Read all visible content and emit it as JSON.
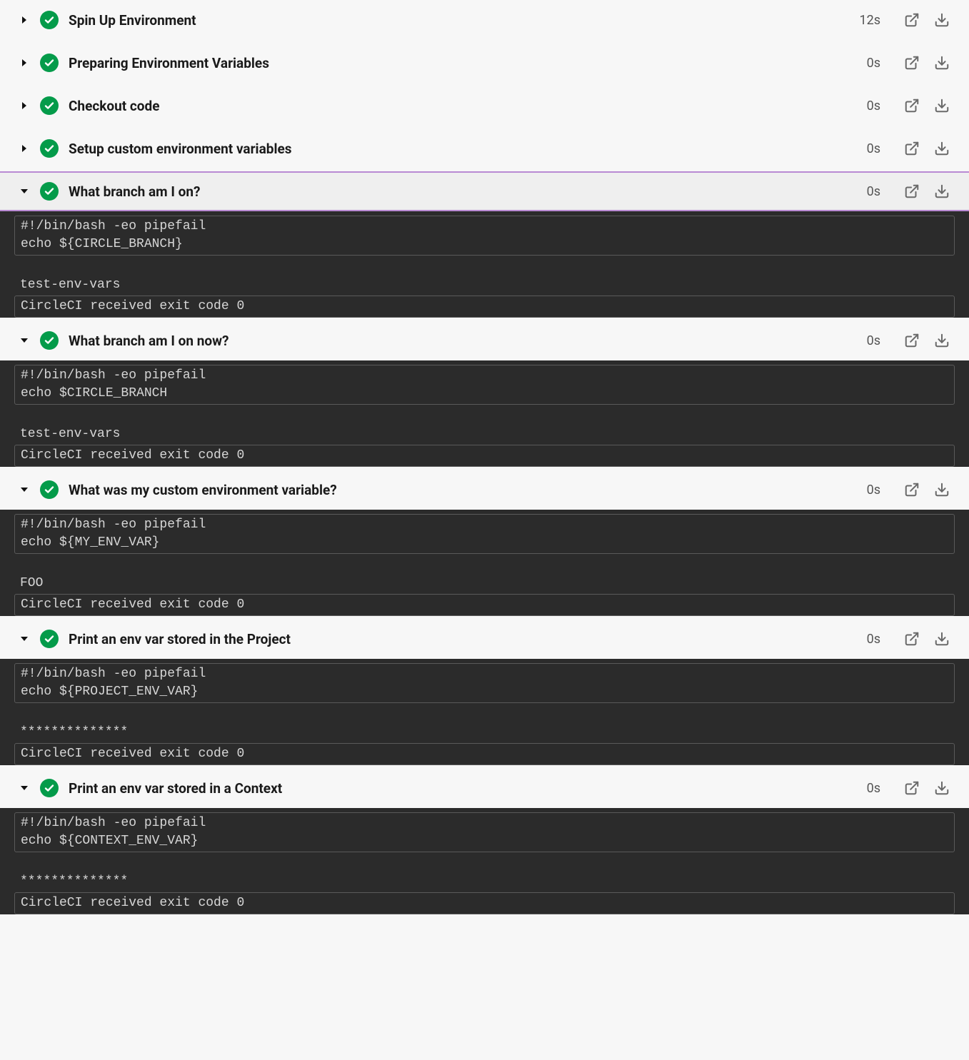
{
  "steps": [
    {
      "title": "Spin Up Environment",
      "duration": "12s",
      "expanded": false,
      "highlighted": false,
      "output": null
    },
    {
      "title": "Preparing Environment Variables",
      "duration": "0s",
      "expanded": false,
      "highlighted": false,
      "output": null
    },
    {
      "title": "Checkout code",
      "duration": "0s",
      "expanded": false,
      "highlighted": false,
      "output": null
    },
    {
      "title": "Setup custom environment variables",
      "duration": "0s",
      "expanded": false,
      "highlighted": false,
      "output": null
    },
    {
      "title": "What branch am I on?",
      "duration": "0s",
      "expanded": true,
      "highlighted": true,
      "output": {
        "cmd": [
          "#!/bin/bash -eo pipefail",
          "echo ${CIRCLE_BRANCH}"
        ],
        "out": [
          "test-env-vars"
        ],
        "exit": "CircleCI received exit code 0"
      }
    },
    {
      "title": "What branch am I on now?",
      "duration": "0s",
      "expanded": true,
      "highlighted": false,
      "output": {
        "cmd": [
          "#!/bin/bash -eo pipefail",
          "echo $CIRCLE_BRANCH"
        ],
        "out": [
          "test-env-vars"
        ],
        "exit": "CircleCI received exit code 0"
      }
    },
    {
      "title": "What was my custom environment variable?",
      "duration": "0s",
      "expanded": true,
      "highlighted": false,
      "output": {
        "cmd": [
          "#!/bin/bash -eo pipefail",
          "echo ${MY_ENV_VAR}"
        ],
        "out": [
          "FOO"
        ],
        "exit": "CircleCI received exit code 0"
      }
    },
    {
      "title": "Print an env var stored in the Project",
      "duration": "0s",
      "expanded": true,
      "highlighted": false,
      "output": {
        "cmd": [
          "#!/bin/bash -eo pipefail",
          "echo ${PROJECT_ENV_VAR}"
        ],
        "out": [
          "**************"
        ],
        "exit": "CircleCI received exit code 0"
      }
    },
    {
      "title": "Print an env var stored in a Context",
      "duration": "0s",
      "expanded": true,
      "highlighted": false,
      "output": {
        "cmd": [
          "#!/bin/bash -eo pipefail",
          "echo ${CONTEXT_ENV_VAR}"
        ],
        "out": [
          "**************"
        ],
        "exit": "CircleCI received exit code 0"
      }
    }
  ]
}
